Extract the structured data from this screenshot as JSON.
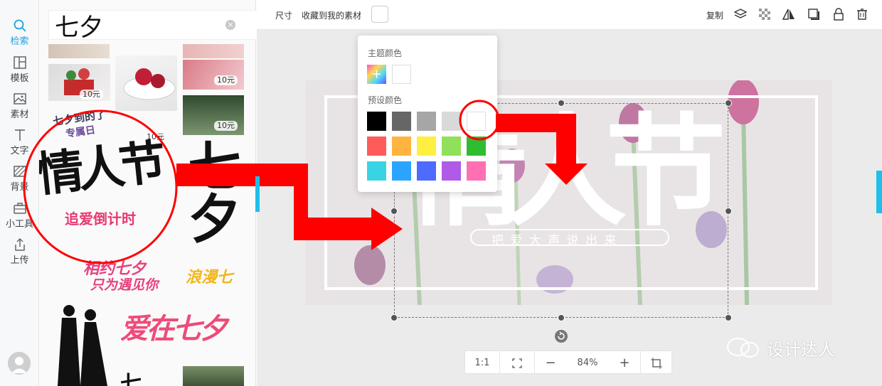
{
  "nav": {
    "items": [
      {
        "label": "检索",
        "icon": "search-icon",
        "active": true
      },
      {
        "label": "模板",
        "icon": "template-icon"
      },
      {
        "label": "素材",
        "icon": "image-icon"
      },
      {
        "label": "文字",
        "icon": "text-icon"
      },
      {
        "label": "背景",
        "icon": "background-icon"
      },
      {
        "label": "小工具",
        "icon": "toolbox-icon"
      },
      {
        "label": "上传",
        "icon": "upload-icon"
      }
    ]
  },
  "search": {
    "value": "七夕"
  },
  "assets": {
    "price_labels": [
      "10元",
      "10元",
      "10元",
      "10元"
    ],
    "featured_text": "情人节",
    "featured_sub": "追爱倒计时",
    "sticker_1": "七夕",
    "sticker_2": "相约七夕",
    "sticker_2b": "只为遇见你",
    "sticker_3": "浪漫七夕",
    "sticker_4": "爱在七夕",
    "sticker_5": "七夕到的了",
    "sticker_5b": "专属日"
  },
  "toolbar": {
    "size_label": "尺寸",
    "favorite_label": "收藏到我的素材",
    "copy_label": "复制"
  },
  "color_picker": {
    "theme_title": "主题颜色",
    "preset_title": "预设颜色",
    "theme_colors": [
      "#ffffff"
    ],
    "preset_colors": [
      "#000000",
      "#666666",
      "#a6a6a6",
      "#d9d9d9",
      "#ffffff",
      "#ff5b5b",
      "#ffb440",
      "#ffef40",
      "#90e05a",
      "#2ebd31",
      "#39d4e3",
      "#2aa4ff",
      "#4d6bff",
      "#b05ae8",
      "#ff6fb4"
    ]
  },
  "canvas": {
    "headline": "情人节",
    "tagline": "把 爱 大 声 说 出 来"
  },
  "zoom": {
    "ratio_label": "1:1",
    "level": "84%",
    "minus": "−",
    "plus": "+"
  },
  "watermark": {
    "text": "设计达人"
  },
  "accent_color": "#1fa3d8",
  "annotation_color": "#ff0000"
}
